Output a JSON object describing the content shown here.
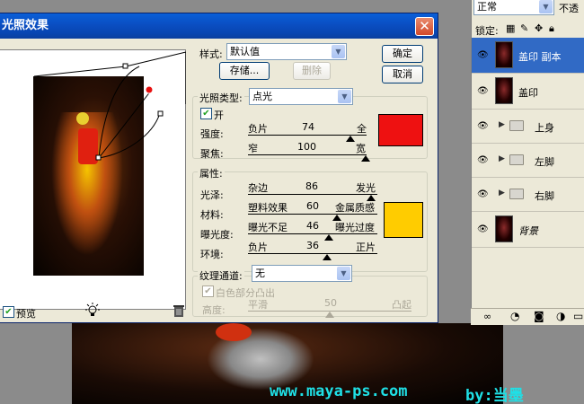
{
  "dialog": {
    "title": "光照效果",
    "close_icon": "close-icon",
    "style_label": "样式:",
    "style_value": "默认值",
    "save_label": "存储...",
    "delete_label": "删除",
    "ok_label": "确定",
    "cancel_label": "取消",
    "light_type_label": "光照类型:",
    "light_type_value": "点光",
    "on_label": "开",
    "intensity_label": "强度:",
    "intensity_min": "负片",
    "intensity_value": "74",
    "intensity_max": "全",
    "focus_label": "聚焦:",
    "focus_min": "窄",
    "focus_value": "100",
    "focus_max": "宽",
    "light_color": "#ee1111",
    "properties_label": "属性:",
    "gloss_label": "光泽:",
    "gloss_min": "杂边",
    "gloss_value": "86",
    "gloss_max": "发光",
    "material_label": "材料:",
    "material_min": "塑料效果",
    "material_value": "60",
    "material_max": "金属质感",
    "exposure_label": "曝光度:",
    "exposure_min": "曝光不足",
    "exposure_value": "46",
    "exposure_max": "曝光过度",
    "ambience_label": "环境:",
    "ambience_min": "负片",
    "ambience_value": "36",
    "ambience_max": "正片",
    "ambient_color": "#ffcc00",
    "texture_label": "纹理通道:",
    "texture_value": "无",
    "white_high_label": "白色部分凸出",
    "height_label": "高度:",
    "height_min": "平滑",
    "height_value": "50",
    "height_max": "凸起",
    "preview_label": "预览",
    "bulb_icon": "lightbulb-icon",
    "trash_icon": "trash-icon"
  },
  "layers": {
    "blend_mode": "正常",
    "opacity_label": "不透",
    "lock_label": "锁定:",
    "items": [
      {
        "name": "盖印 副本",
        "type": "layer"
      },
      {
        "name": "盖印",
        "type": "layer"
      },
      {
        "name": "上身",
        "type": "group"
      },
      {
        "name": "左脚",
        "type": "group"
      },
      {
        "name": "右脚",
        "type": "group"
      },
      {
        "name": "背景",
        "type": "background"
      }
    ]
  },
  "watermark": {
    "site": "www.maya-ps.com",
    "author": "by:当墨"
  }
}
